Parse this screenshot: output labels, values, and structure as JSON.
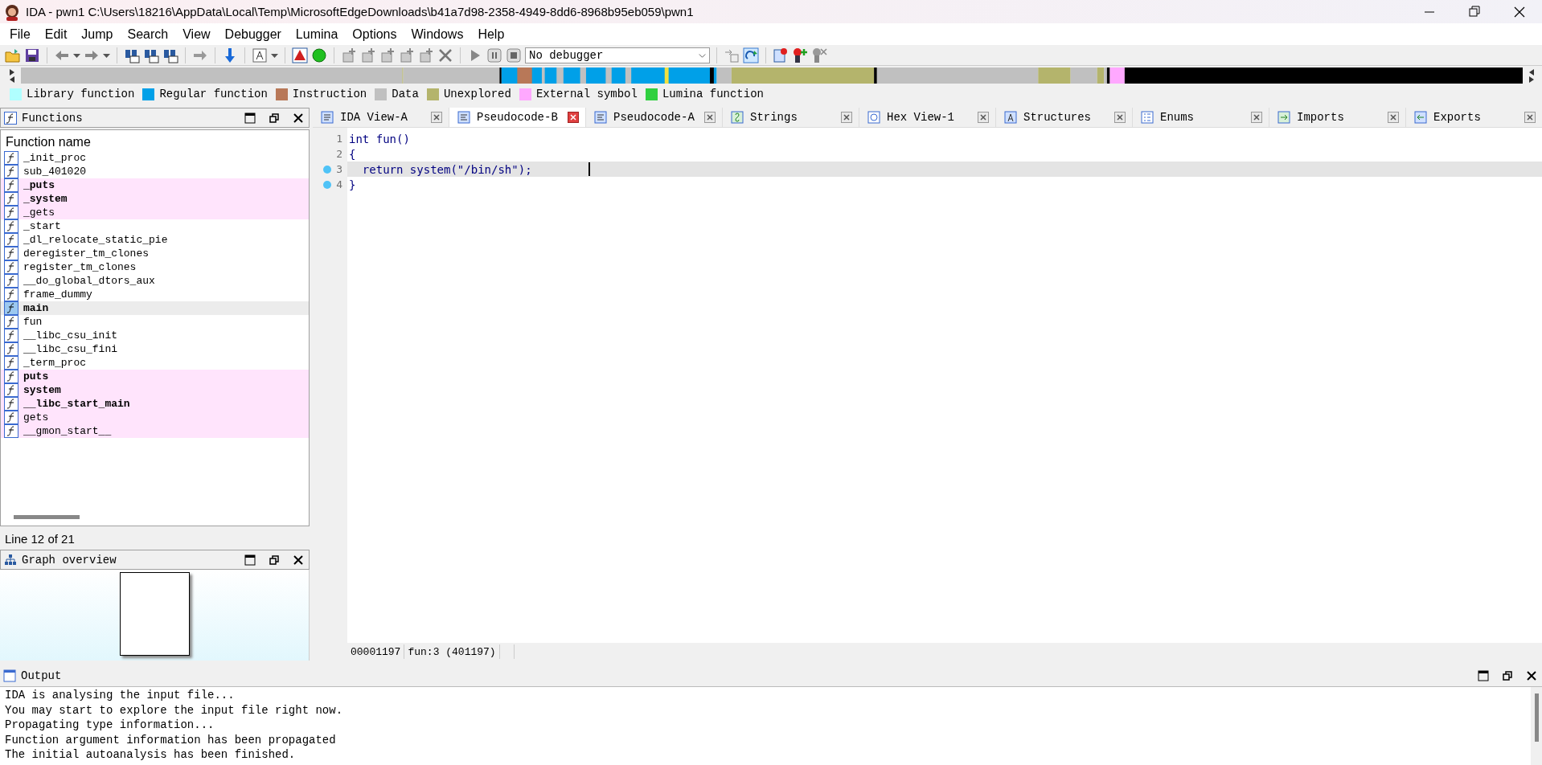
{
  "window": {
    "title": "IDA - pwn1 C:\\Users\\18216\\AppData\\Local\\Temp\\MicrosoftEdgeDownloads\\b41a7d98-2358-4949-8dd6-8968b95eb059\\pwn1"
  },
  "menu": [
    "File",
    "Edit",
    "Jump",
    "Search",
    "View",
    "Debugger",
    "Lumina",
    "Options",
    "Windows",
    "Help"
  ],
  "toolbar": {
    "debugger_select": {
      "value": "No debugger"
    }
  },
  "legend": [
    {
      "label": "Library function",
      "color": "#b0ffff"
    },
    {
      "label": "Regular function",
      "color": "#00a0e8"
    },
    {
      "label": "Instruction",
      "color": "#b87858"
    },
    {
      "label": "Data",
      "color": "#c0c0c0"
    },
    {
      "label": "Unexplored",
      "color": "#b4b46c"
    },
    {
      "label": "External symbol",
      "color": "#ffa8ff"
    },
    {
      "label": "Lumina function",
      "color": "#30d040"
    }
  ],
  "functions_panel": {
    "title": "Functions",
    "column": "Function name",
    "status": "Line 12 of 21",
    "items": [
      {
        "name": "_init_proc",
        "bold": false,
        "imported": false,
        "selected": false
      },
      {
        "name": "sub_401020",
        "bold": false,
        "imported": false,
        "selected": false
      },
      {
        "name": "_puts",
        "bold": true,
        "imported": true,
        "selected": false
      },
      {
        "name": "_system",
        "bold": true,
        "imported": true,
        "selected": false
      },
      {
        "name": "_gets",
        "bold": false,
        "imported": true,
        "selected": false
      },
      {
        "name": "_start",
        "bold": false,
        "imported": false,
        "selected": false
      },
      {
        "name": "_dl_relocate_static_pie",
        "bold": false,
        "imported": false,
        "selected": false
      },
      {
        "name": "deregister_tm_clones",
        "bold": false,
        "imported": false,
        "selected": false
      },
      {
        "name": "register_tm_clones",
        "bold": false,
        "imported": false,
        "selected": false
      },
      {
        "name": "__do_global_dtors_aux",
        "bold": false,
        "imported": false,
        "selected": false
      },
      {
        "name": "frame_dummy",
        "bold": false,
        "imported": false,
        "selected": false
      },
      {
        "name": "main",
        "bold": true,
        "imported": false,
        "selected": true
      },
      {
        "name": "fun",
        "bold": false,
        "imported": false,
        "selected": false
      },
      {
        "name": "__libc_csu_init",
        "bold": false,
        "imported": false,
        "selected": false
      },
      {
        "name": "__libc_csu_fini",
        "bold": false,
        "imported": false,
        "selected": false
      },
      {
        "name": "_term_proc",
        "bold": false,
        "imported": false,
        "selected": false
      },
      {
        "name": "puts",
        "bold": true,
        "imported": true,
        "selected": false
      },
      {
        "name": "system",
        "bold": true,
        "imported": true,
        "selected": false
      },
      {
        "name": "__libc_start_main",
        "bold": true,
        "imported": true,
        "selected": false
      },
      {
        "name": "gets",
        "bold": false,
        "imported": true,
        "selected": false
      },
      {
        "name": "__gmon_start__",
        "bold": false,
        "imported": true,
        "selected": false
      }
    ]
  },
  "graph_overview": {
    "title": "Graph overview"
  },
  "tabs": [
    {
      "label": "IDA View-A",
      "kind": "disasm",
      "selected": false
    },
    {
      "label": "Pseudocode-B",
      "kind": "pseudocode",
      "selected": true
    },
    {
      "label": "Pseudocode-A",
      "kind": "pseudocode",
      "selected": false
    },
    {
      "label": "Strings",
      "kind": "strings",
      "selected": false
    },
    {
      "label": "Hex View-1",
      "kind": "hex",
      "selected": false
    },
    {
      "label": "Structures",
      "kind": "structures",
      "selected": false
    },
    {
      "label": "Enums",
      "kind": "enums",
      "selected": false
    },
    {
      "label": "Imports",
      "kind": "imports",
      "selected": false
    },
    {
      "label": "Exports",
      "kind": "exports",
      "selected": false
    }
  ],
  "editor": {
    "lines": [
      {
        "number": "1",
        "text": "int fun()",
        "breakpoint": false,
        "current": false
      },
      {
        "number": "2",
        "text": "{",
        "breakpoint": false,
        "current": false
      },
      {
        "number": "3",
        "text": "  return system(\"/bin/sh\");",
        "breakpoint": true,
        "current": true
      },
      {
        "number": "4",
        "text": "}",
        "breakpoint": true,
        "current": false
      }
    ],
    "status": [
      "00001197",
      "fun:3 (401197)"
    ]
  },
  "output": {
    "title": "Output",
    "lines": [
      "IDA is analysing the input file...",
      "You may start to explore the input file right now.",
      "Propagating type information...",
      "Function argument information has been propagated",
      "The initial autoanalysis has been finished."
    ]
  }
}
